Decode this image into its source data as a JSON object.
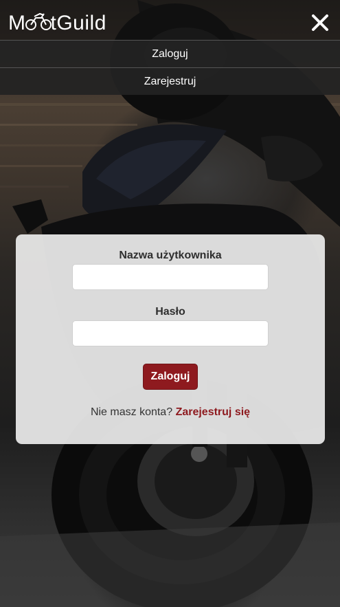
{
  "header": {
    "logo_text_left": "M",
    "logo_text_mid": "t",
    "logo_text_right": "Guild",
    "logo_icon": "motorcycle-icon",
    "close_icon": "close-icon"
  },
  "nav": {
    "items": [
      {
        "label": "Zaloguj"
      },
      {
        "label": "Zarejestruj"
      }
    ]
  },
  "login_form": {
    "username_label": "Nazwa użytkownika",
    "username_value": "",
    "password_label": "Hasło",
    "password_value": "",
    "submit_label": "Zaloguj",
    "no_account_text": "Nie masz konta?",
    "register_link": "Zarejestruj się"
  },
  "colors": {
    "accent": "#8e1a1f",
    "header_bg": "#232323",
    "card_bg": "#ebebeb"
  }
}
